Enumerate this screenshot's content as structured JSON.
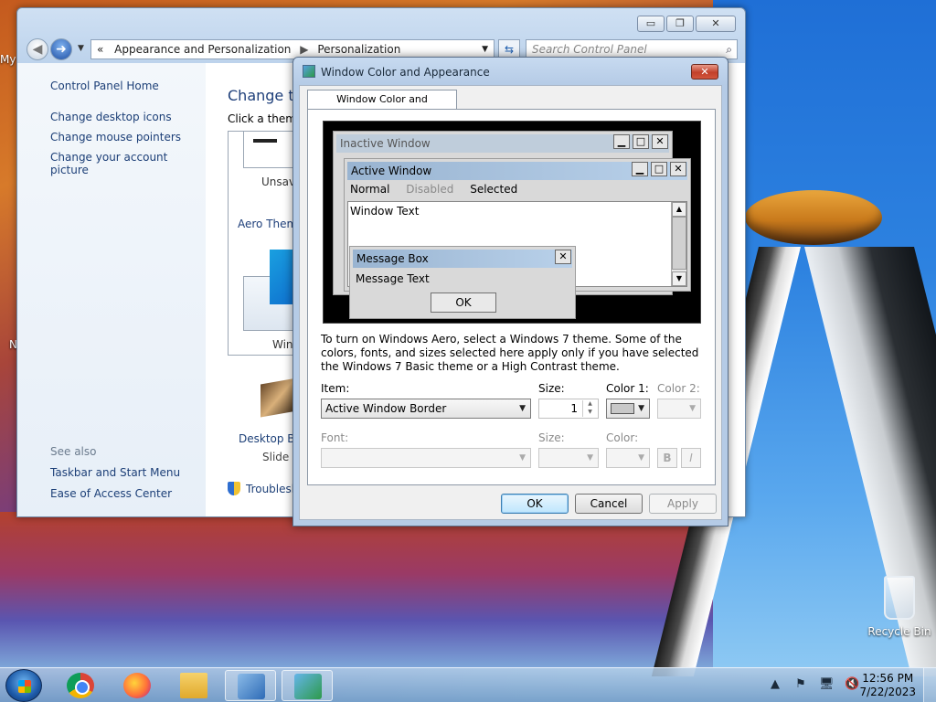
{
  "desktop": {
    "icon_labels": [
      "My",
      "N"
    ],
    "recycle_bin_label": "Recycle Bin"
  },
  "control_panel": {
    "nav_back_glyph": "◀",
    "nav_forward_glyph": "➜",
    "nav_recent_glyph": "▼",
    "address_lead": "«",
    "address_crumbs": [
      "Appearance and Personalization",
      "Personalization"
    ],
    "address_sep_glyph": "▶",
    "address_drop_glyph": "▼",
    "refresh_glyph": "⇆",
    "search_placeholder": "Search Control Panel",
    "search_icon": "search-icon",
    "help_glyph": "?",
    "caption": {
      "minimize": "▭",
      "maximize": "❐",
      "close": "✕"
    },
    "left_links": [
      "Control Panel Home",
      "Change desktop icons",
      "Change mouse pointers",
      "Change your account picture"
    ],
    "see_also_title": "See also",
    "see_also_links": [
      "Taskbar and Start Menu",
      "Ease of Access Center"
    ],
    "main_title": "Change th",
    "main_sub": "Click a theme",
    "theme_unsaved_label": "Unsave",
    "aero_section": "Aero Them",
    "theme_windows_label": "Win",
    "desktop_bg_label": "Desktop Ba",
    "desktop_bg_sub": "Slide S",
    "troubleshoot_label": "Troublesh"
  },
  "dialog": {
    "title": "Window Color and Appearance",
    "close_glyph": "✕",
    "tab_label": "Window Color and Appearance",
    "preview": {
      "inactive_title": "Inactive Window",
      "active_title": "Active Window",
      "caption_glyphs": [
        "▁",
        "□",
        "✕"
      ],
      "menu": {
        "normal": "Normal",
        "disabled": "Disabled",
        "selected": "Selected"
      },
      "window_text": "Window Text",
      "scroll_up": "▲",
      "scroll_down": "▼",
      "msgbox_title": "Message Box",
      "msgbox_close": "✕",
      "msgbox_text": "Message Text",
      "msgbox_ok": "OK"
    },
    "info_text": "To turn on Windows Aero, select a Windows 7 theme.  Some of the colors, fonts, and sizes selected here apply only if you have selected the Windows 7 Basic theme or a High Contrast theme.",
    "item_label": "Item:",
    "item_value": "Active Window Border",
    "size_label": "Size:",
    "size_value": "1",
    "color1_label": "Color 1:",
    "color1_swatch": "#c8c8c8",
    "color2_label": "Color 2:",
    "font_label": "Font:",
    "font_size_label": "Size:",
    "font_color_label": "Color:",
    "bold_label": "B",
    "italic_label": "I",
    "drop_glyph": "▼",
    "spin_up": "▲",
    "spin_down": "▼",
    "buttons": {
      "ok": "OK",
      "cancel": "Cancel",
      "apply": "Apply"
    }
  },
  "taskbar": {
    "apps": [
      "chrome-icon",
      "firefox-icon",
      "file-explorer-icon",
      "control-panel-icon",
      "window-color-icon"
    ],
    "tray_glyphs": [
      "▲",
      "⚑",
      "🖥",
      "🔇"
    ],
    "time": "12:56 PM",
    "date": "7/22/2023"
  }
}
